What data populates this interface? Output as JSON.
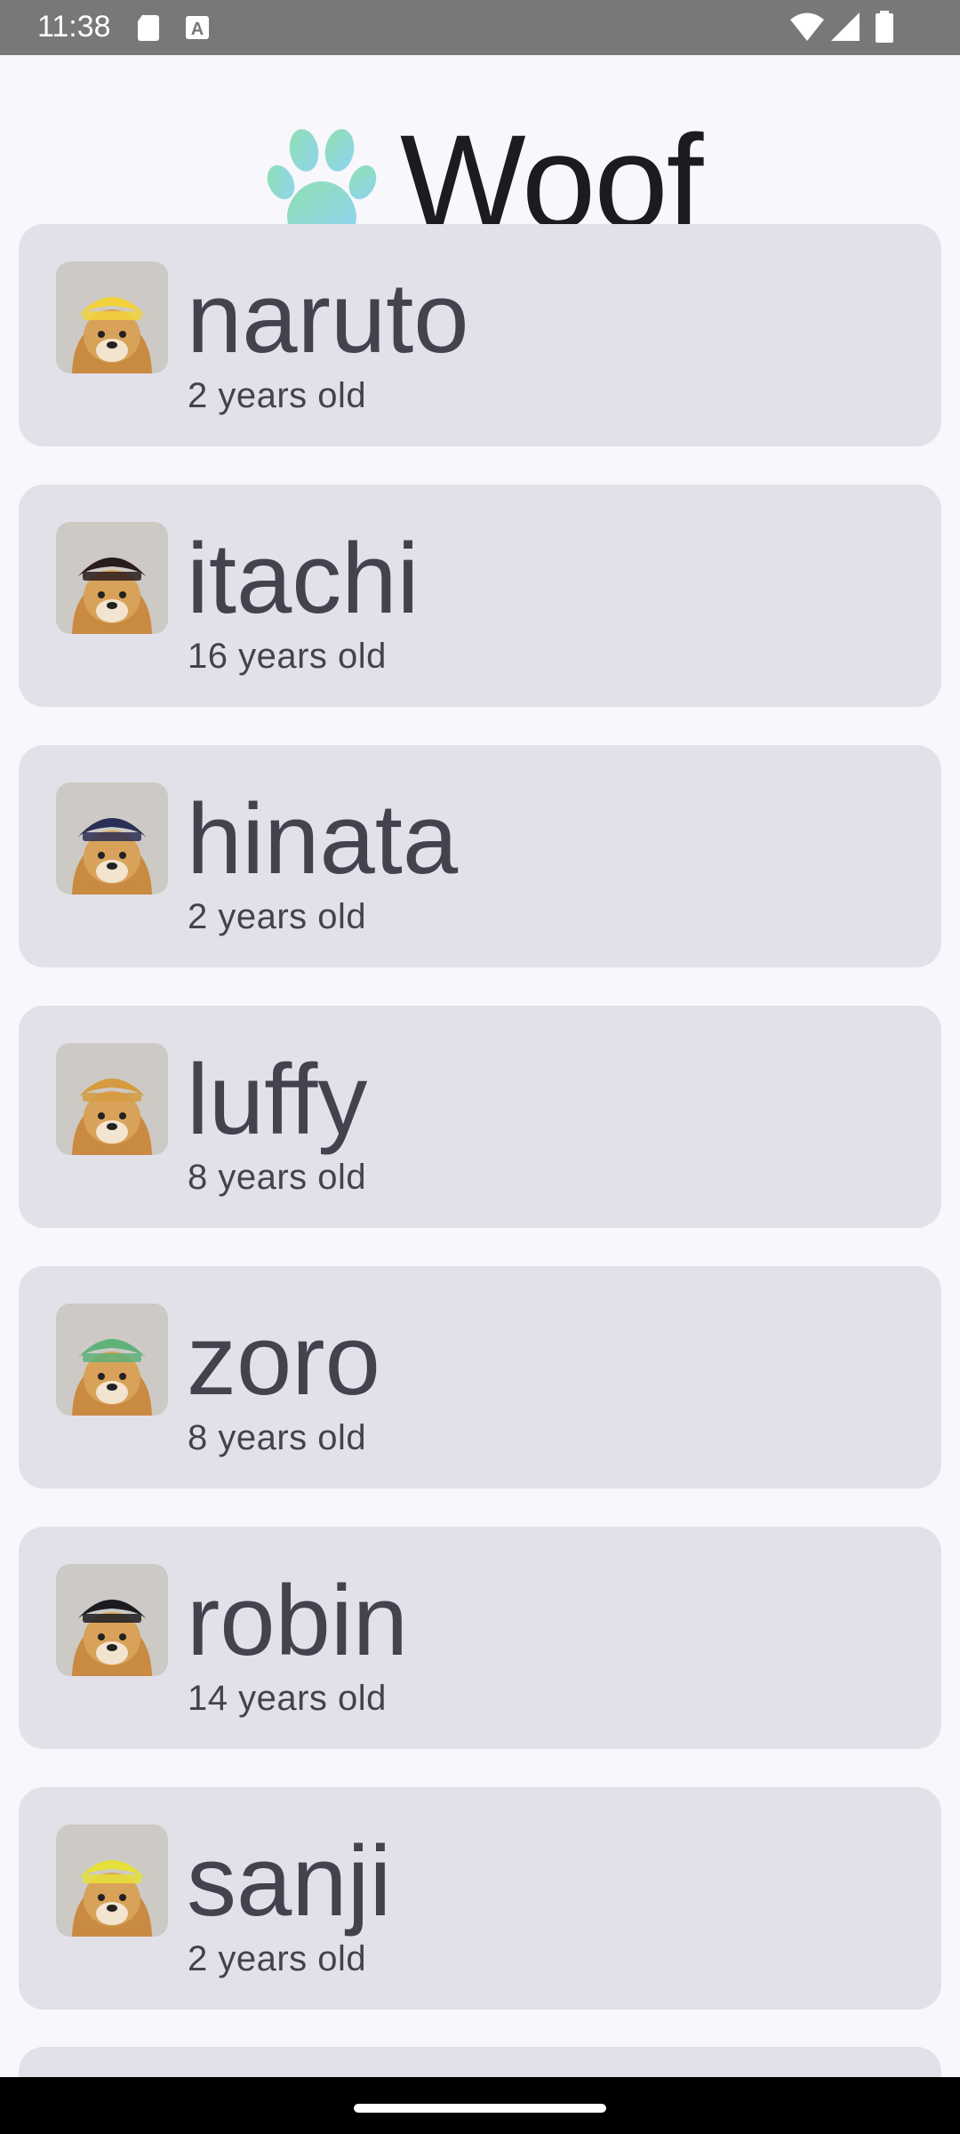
{
  "status_bar": {
    "time": "11:38",
    "icons": [
      "sd-card-icon",
      "a-notification-icon",
      "wifi-icon",
      "signal-icon",
      "battery-icon"
    ]
  },
  "app": {
    "title": "Woof",
    "logo_icon": "paw-icon"
  },
  "dogs": [
    {
      "name": "naruto",
      "age": "2 years old",
      "hair": "#f2d33b"
    },
    {
      "name": "itachi",
      "age": "16 years old",
      "hair": "#2a1c1c"
    },
    {
      "name": "hinata",
      "age": "2 years old",
      "hair": "#2a2f55"
    },
    {
      "name": "luffy",
      "age": "8 years old",
      "hair": "#d49b3f"
    },
    {
      "name": "zoro",
      "age": "8 years old",
      "hair": "#5fb27a"
    },
    {
      "name": "robin",
      "age": "14 years old",
      "hair": "#1b1b22"
    },
    {
      "name": "sanji",
      "age": "2 years old",
      "hair": "#e6e03a"
    }
  ],
  "colors": {
    "background": "#f7f7fc",
    "card": "#e2e1ea",
    "title_text": "#1c1b21",
    "card_text": "#44424f",
    "status_bar": "#787878"
  }
}
